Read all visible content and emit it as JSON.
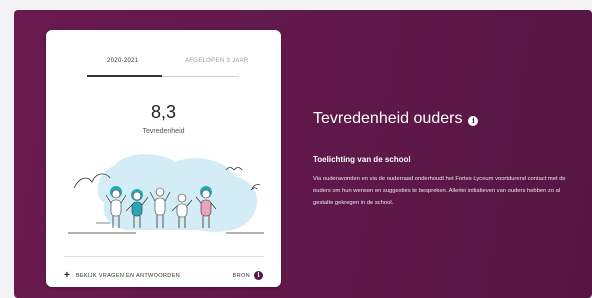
{
  "card": {
    "tabs": [
      {
        "label": "2020-2021",
        "active": true
      },
      {
        "label": "AFGELOPEN 3 JAAR",
        "active": false
      }
    ],
    "score": "8,3",
    "score_label": "Tevredenheid",
    "faq_link": "BEKIJK VRAGEN EN ANTWOORDEN",
    "source_label": "BRON"
  },
  "main": {
    "title": "Tevredenheid ouders",
    "subtitle": "Toelichting van de school",
    "explanation": "Via ouderavonden en via de ouderraad onderhoudt het Fortes Lyceum voortdurend contact met de ouders om hun wensen en suggesties te bespreken. Allerlei initiatieven van ouders hebben zo al gestalte gekregen in de school."
  },
  "colors": {
    "panel_bg": "#5e1849",
    "illustration_sky": "#cfe9f5",
    "figure_teal": "#2aa7b5",
    "figure_pink": "#e6a3b9"
  },
  "icons": {
    "info": "info-icon",
    "source": "info-icon",
    "faq": "plus-icon"
  }
}
